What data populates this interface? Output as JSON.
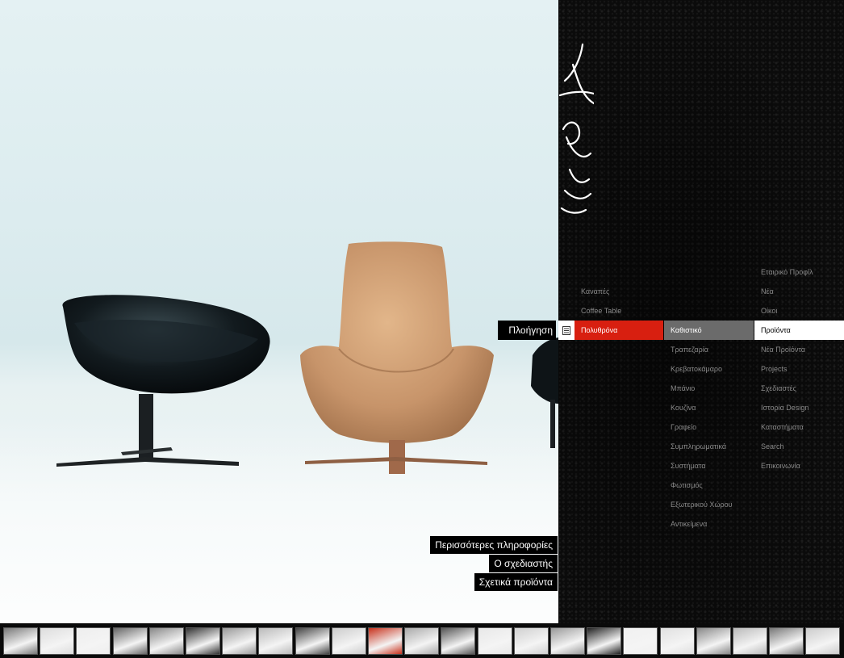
{
  "navigation": {
    "label": "Πλοήγηση",
    "icon": "document-list-icon"
  },
  "menu": {
    "categories": [
      {
        "label": "Καναπές",
        "state": "normal"
      },
      {
        "label": "Coffee Table",
        "state": "normal"
      },
      {
        "label": "Πολυθρόνα",
        "state": "active"
      }
    ],
    "subcategories": [
      {
        "label": "Καθιστικό",
        "state": "active"
      },
      {
        "label": "Τραπεζαρία",
        "state": "normal"
      },
      {
        "label": "Κρεβατοκάμαρο",
        "state": "normal"
      },
      {
        "label": "Μπάνιο",
        "state": "normal"
      },
      {
        "label": "Κουζίνα",
        "state": "normal"
      },
      {
        "label": "Γραφείο",
        "state": "normal"
      },
      {
        "label": "Συμπληρωματικά",
        "state": "normal"
      },
      {
        "label": "Συστήματα",
        "state": "normal"
      },
      {
        "label": "Φωτισμός",
        "state": "normal"
      },
      {
        "label": "Εξωτερικού Χώρου",
        "state": "normal"
      },
      {
        "label": "Αντικείμενα",
        "state": "normal"
      }
    ],
    "main": [
      {
        "label": "Εταιρικό Προφίλ",
        "state": "normal"
      },
      {
        "label": "Νέα",
        "state": "normal"
      },
      {
        "label": "Οίκοι",
        "state": "normal"
      },
      {
        "label": "Προϊόντα",
        "state": "active"
      },
      {
        "label": "Νέα Προϊόντα",
        "state": "normal"
      },
      {
        "label": "Projects",
        "state": "normal"
      },
      {
        "label": "Σχεδιαστές",
        "state": "normal"
      },
      {
        "label": "Ιστορία Design",
        "state": "normal"
      },
      {
        "label": "Καταστήματα",
        "state": "normal"
      },
      {
        "label": "Search",
        "state": "normal"
      },
      {
        "label": "Επικοινωνία",
        "state": "normal"
      }
    ]
  },
  "info_links": {
    "more_info": "Περισσότερες πληροφορίες",
    "designer": "Ο σχεδιαστής",
    "related": "Σχετικά προϊόντα"
  },
  "colors": {
    "accent_red": "#d81f10",
    "active_gray": "#6b6b6b",
    "panel_bg": "#0b0b0b"
  },
  "thumbnails": [
    {
      "tone": "#777"
    },
    {
      "tone": "#ddd"
    },
    {
      "tone": "#eee"
    },
    {
      "tone": "#666"
    },
    {
      "tone": "#888"
    },
    {
      "tone": "#333"
    },
    {
      "tone": "#999"
    },
    {
      "tone": "#bbb"
    },
    {
      "tone": "#444"
    },
    {
      "tone": "#ccc"
    },
    {
      "tone": "#c8311c"
    },
    {
      "tone": "#aaa"
    },
    {
      "tone": "#555"
    },
    {
      "tone": "#e8e8e8"
    },
    {
      "tone": "#d0d0d0"
    },
    {
      "tone": "#999"
    },
    {
      "tone": "#222"
    },
    {
      "tone": "#f0f0f0"
    },
    {
      "tone": "#e0e0e0"
    },
    {
      "tone": "#888"
    },
    {
      "tone": "#bbb"
    },
    {
      "tone": "#777"
    },
    {
      "tone": "#ccc"
    }
  ]
}
